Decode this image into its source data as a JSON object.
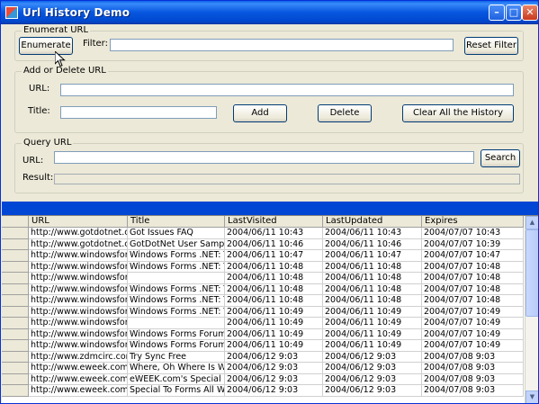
{
  "window": {
    "title": "Url History Demo"
  },
  "enumerate": {
    "group_label": "Enumerat URL",
    "button": "Enumerate",
    "filter_label": "Filter:",
    "filter_value": "",
    "reset_button": "Reset Filter"
  },
  "add_delete": {
    "group_label": "Add or Delete URL",
    "url_label": "URL:",
    "url_value": "",
    "title_label": "Title:",
    "title_value": "",
    "add_button": "Add",
    "delete_button": "Delete",
    "clear_button": "Clear All the History"
  },
  "query": {
    "group_label": "Query URL",
    "url_label": "URL:",
    "url_value": "",
    "search_button": "Search",
    "result_label": "Result:",
    "result_value": ""
  },
  "grid": {
    "columns": [
      "URL",
      "Title",
      "LastVisited",
      "LastUpdated",
      "Expires"
    ],
    "rows": [
      [
        "http://www.gotdotnet.co",
        "Got Issues FAQ",
        "2004/06/11 10:43",
        "2004/06/11 10:43",
        "2004/07/07 10:43"
      ],
      [
        "http://www.gotdotnet.co",
        "GotDotNet User Sample:",
        "2004/06/11 10:46",
        "2004/06/11 10:46",
        "2004/07/07 10:39"
      ],
      [
        "http://www.windowsforms",
        "Windows Forms .NET: The",
        "2004/06/11 10:47",
        "2004/06/11 10:47",
        "2004/07/07 10:47"
      ],
      [
        "http://www.windowsforms",
        "Windows Forms .NET: The",
        "2004/06/11 10:48",
        "2004/06/11 10:48",
        "2004/07/07 10:48"
      ],
      [
        "http://www.windowsforms",
        "",
        "2004/06/11 10:48",
        "2004/06/11 10:48",
        "2004/07/07 10:48"
      ],
      [
        "http://www.windowsforms",
        "Windows Forms .NET: The",
        "2004/06/11 10:48",
        "2004/06/11 10:48",
        "2004/07/07 10:48"
      ],
      [
        "http://www.windowsforms",
        "Windows Forms .NET: The",
        "2004/06/11 10:48",
        "2004/06/11 10:48",
        "2004/07/07 10:48"
      ],
      [
        "http://www.windowsforms",
        "Windows Forms .NET: The",
        "2004/06/11 10:49",
        "2004/06/11 10:49",
        "2004/07/07 10:49"
      ],
      [
        "http://www.windowsforms",
        "",
        "2004/06/11 10:49",
        "2004/06/11 10:49",
        "2004/07/07 10:49"
      ],
      [
        "http://www.windowsforms",
        "Windows Forms Forums",
        "2004/06/11 10:49",
        "2004/06/11 10:49",
        "2004/07/07 10:49"
      ],
      [
        "http://www.windowsforms",
        "Windows Forms Forums",
        "2004/06/11 10:49",
        "2004/06/11 10:49",
        "2004/07/07 10:49"
      ],
      [
        "http://www.zdmcirc.com/",
        "Try Sync Free",
        "2004/06/12 9:03",
        "2004/06/12 9:03",
        "2004/07/08 9:03"
      ],
      [
        "http://www.eweek.com/a",
        "Where, Oh Where Is Wind",
        "2004/06/12 9:03",
        "2004/06/12 9:03",
        "2004/07/08 9:03"
      ],
      [
        "http://www.eweek.com/c",
        "eWEEK.com's Special Rep",
        "2004/06/12 9:03",
        "2004/06/12 9:03",
        "2004/07/08 9:03"
      ],
      [
        "http://www.eweek.com/c",
        "Special To Forms All Wind",
        "2004/06/12 9:03",
        "2004/06/12 9:03",
        "2004/07/08 9:03"
      ]
    ]
  },
  "icons": {
    "app": "app-icon",
    "minimize": "minimize-icon",
    "maximize": "maximize-icon",
    "close": "close-icon",
    "cursor": "mouse-cursor-icon",
    "scroll_up": "scroll-up-icon",
    "scroll_down": "scroll-down-icon"
  },
  "colors": {
    "titlebar": "#0a62e8",
    "window_bg": "#ece9d8",
    "divider_bar": "#0046d5"
  }
}
